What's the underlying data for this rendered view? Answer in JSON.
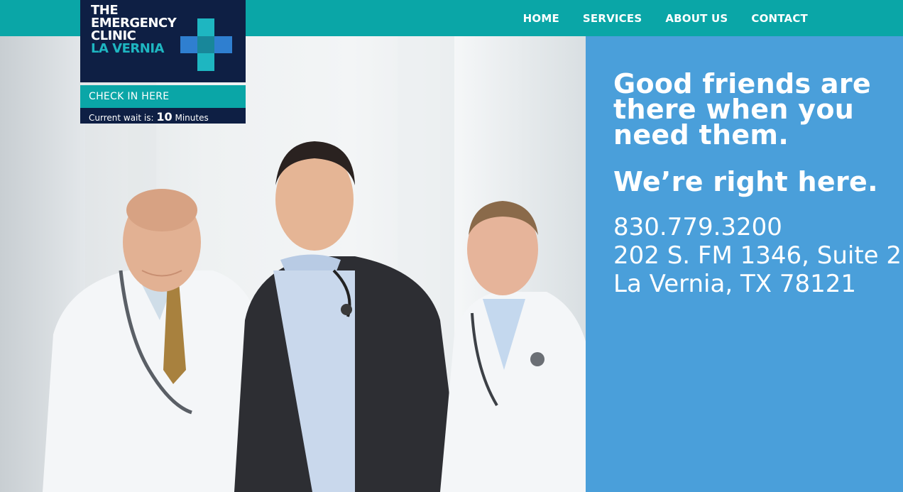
{
  "nav": {
    "home": "HOME",
    "services": "SERVICES",
    "about": "ABOUT US",
    "contact": "CONTACT"
  },
  "logo": {
    "line1": "THE",
    "line2": "EMERGENCY",
    "line3": "CLINIC",
    "line4": "LA VERNIA",
    "icon": "medical-cross-icon"
  },
  "checkin": {
    "label": "CHECK IN HERE",
    "wait_prefix": "Current wait is:",
    "wait_value": "10",
    "wait_unit": "Minutes"
  },
  "hero": {
    "headline": "Good friends are there when you need them.",
    "subheadline": "We’re right here.",
    "phone": "830.779.3200",
    "address_line1": "202 S. FM 1346, Suite 2",
    "address_line2": "La Vernia, TX 78121"
  },
  "colors": {
    "topbar": "#0aa6a7",
    "logo_bg": "#0e1f44",
    "panel": "#4a9fda",
    "accent_teal": "#1eb6c1"
  }
}
